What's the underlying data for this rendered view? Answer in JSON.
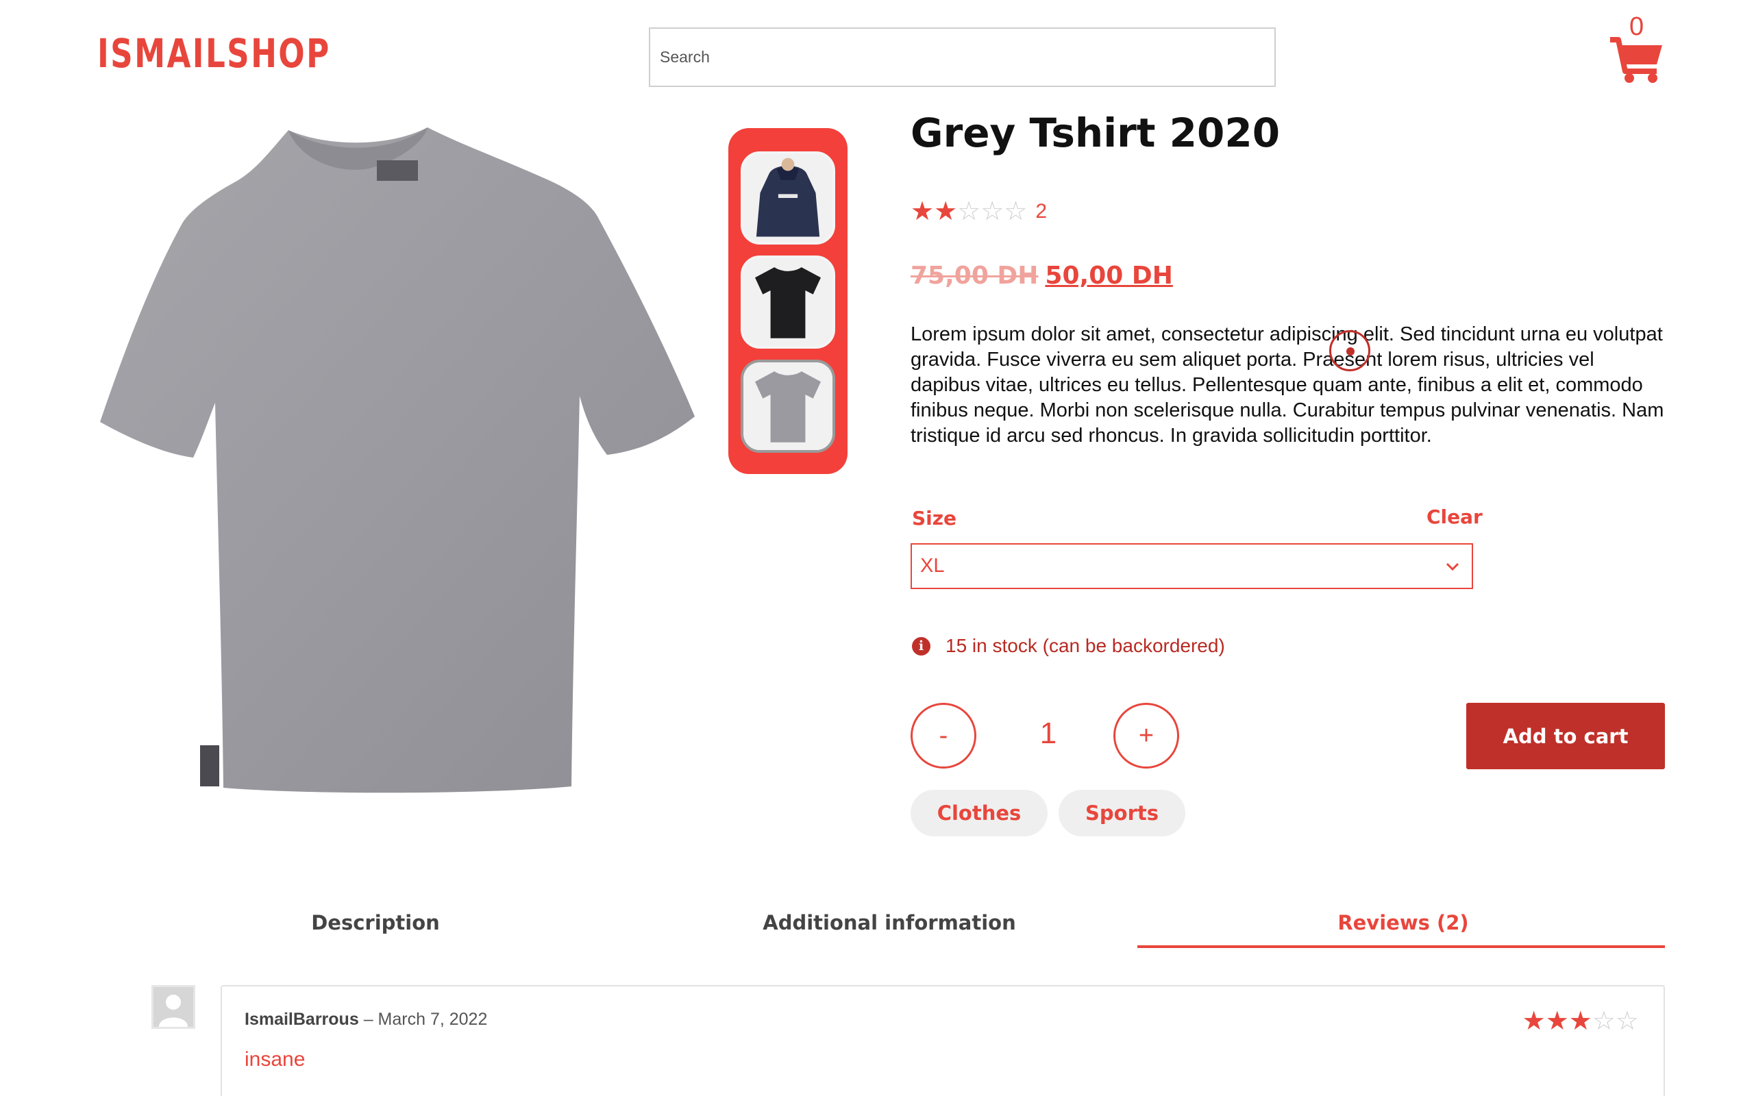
{
  "header": {
    "logo": "ISMAILSHOP",
    "search_placeholder": "Search",
    "cart_count": "0"
  },
  "product": {
    "title": "Grey Tshirt 2020",
    "rating": 2,
    "rating_max": 5,
    "rating_count": "2",
    "price_old": "75,00 DH",
    "price_new": "50,00 DH",
    "description": "Lorem ipsum dolor sit amet, consectetur adipiscing elit. Sed tincidunt urna eu volutpat gravida. Fusce viverra eu sem aliquet porta. Praesent lorem risus, ultricies vel dapibus vitae, ultrices eu tellus. Pellentesque quam ante, finibus a elit et, commodo finibus neque. Morbi non scelerisque nulla. Curabitur tempus pulvinar venenatis. Nam tristique id arcu sed rhoncus. In gravida sollicitudin porttitor.",
    "size_label": "Size",
    "clear_label": "Clear",
    "size_selected": "XL",
    "stock_text": "15 in stock (can be backordered)",
    "quantity": "1",
    "minus_label": "-",
    "plus_label": "+",
    "add_to_cart": "Add to cart",
    "tags": [
      "Clothes",
      "Sports"
    ]
  },
  "thumbnails": [
    {
      "name": "navy-hoodie"
    },
    {
      "name": "black-tshirt"
    },
    {
      "name": "grey-tshirt",
      "active": true
    }
  ],
  "tabs": [
    {
      "label": "Description"
    },
    {
      "label": "Additional information"
    },
    {
      "label": "Reviews (2)",
      "active": true
    }
  ],
  "review": {
    "author": "IsmailBarrous",
    "separator": " – ",
    "date": "March 7, 2022",
    "text": "insane",
    "rating": 3,
    "rating_max": 5
  },
  "colors": {
    "accent": "#e8463c",
    "button": "#c0302a",
    "tag_bg": "#efefef"
  }
}
